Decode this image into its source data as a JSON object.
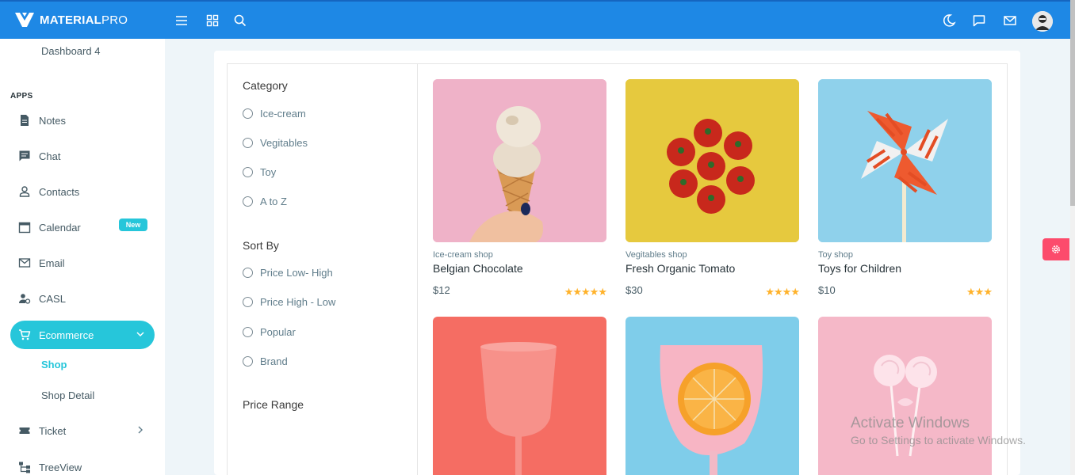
{
  "brand": {
    "bold": "MATERIAL",
    "thin": "PRO"
  },
  "colors": {
    "primary": "#1e88e5",
    "accent": "#26c6da",
    "danger": "#fc4b6c",
    "star": "#ffb22b"
  },
  "topbar": {
    "left_icons": [
      "menu-icon",
      "apps-grid-icon",
      "search-icon"
    ],
    "right_icons": [
      "moon-icon",
      "chat-bubble-icon",
      "mail-icon",
      "avatar"
    ]
  },
  "sidebar": {
    "dashboard_sub": "Dashboard 4",
    "section": "APPS",
    "items": [
      {
        "label": "Notes",
        "icon": "document-icon"
      },
      {
        "label": "Chat",
        "icon": "chat-icon"
      },
      {
        "label": "Contacts",
        "icon": "person-icon"
      },
      {
        "label": "Calendar",
        "icon": "calendar-icon"
      },
      {
        "label": "Email",
        "icon": "mail-icon",
        "badge": "New"
      },
      {
        "label": "CASL",
        "icon": "user-gear-icon"
      },
      {
        "label": "Ecommerce",
        "icon": "cart-icon",
        "active": true
      },
      {
        "label": "Ticket",
        "icon": "ticket-icon"
      },
      {
        "label": "TreeView",
        "icon": "tree-icon"
      }
    ],
    "ecommerce_sub": [
      "Shop",
      "Shop Detail"
    ]
  },
  "filters": {
    "category_title": "Category",
    "categories": [
      "Ice-cream",
      "Vegitables",
      "Toy",
      "A to Z"
    ],
    "sort_title": "Sort By",
    "sorts": [
      "Price Low- High",
      "Price High - Low",
      "Popular",
      "Brand"
    ],
    "price_title": "Price Range"
  },
  "products": [
    {
      "category": "Ice-cream shop",
      "name": "Belgian Chocolate",
      "price": "$12",
      "stars": "★★★★★",
      "rating": 5
    },
    {
      "category": "Vegitables shop",
      "name": "Fresh Organic Tomato",
      "price": "$30",
      "stars": "★★★★",
      "rating": 4
    },
    {
      "category": "Toy shop",
      "name": "Toys for Children",
      "price": "$10",
      "stars": "★★★",
      "rating": 3
    }
  ],
  "watermark": {
    "line1": "Activate Windows",
    "line2": "Go to Settings to activate Windows."
  }
}
